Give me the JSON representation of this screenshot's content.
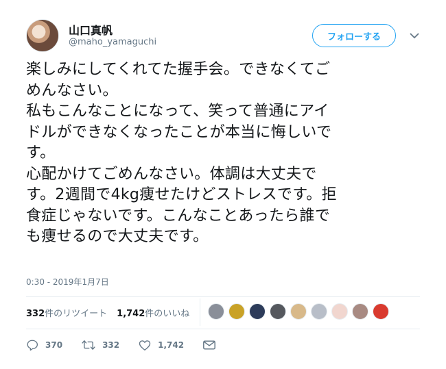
{
  "author": {
    "display_name": "山口真帆",
    "handle": "@maho_yamaguchi"
  },
  "follow_button_label": "フォローする",
  "tweet": {
    "lines": [
      "楽しみにしてくれてた握手会。できなくてご",
      "めんなさい。",
      "私もこんなことになって、笑って普通にアイ",
      "ドルができなくなったことが本当に悔しいで",
      "す。",
      "心配かけてごめんなさい。体調は大丈夫で",
      "す。2週間で4kg痩せたけどストレスです。拒",
      "食症じゃないです。こんなことあったら誰で",
      "も痩せるので大丈夫です。"
    ],
    "timestamp": "0:30 - 2019年1月7日"
  },
  "stats": {
    "retweets_count": "332",
    "retweets_label": "件のリツイート",
    "likes_count": "1,742",
    "likes_label": "件のいいね"
  },
  "liker_avatars": [
    {
      "color": "#8a8f99"
    },
    {
      "color": "#c9a227"
    },
    {
      "color": "#2d3c5a"
    },
    {
      "color": "#55585e"
    },
    {
      "color": "#d8b98a"
    },
    {
      "color": "#b8bec8"
    },
    {
      "color": "#f1d6cf"
    },
    {
      "color": "#a88a82"
    },
    {
      "color": "#d93a2f"
    }
  ],
  "actions": {
    "replies": "370",
    "retweets": "332",
    "likes": "1,742"
  },
  "colors": {
    "accent": "#1da1f2",
    "secondary_text": "#657786",
    "divider": "#e6ecf0"
  }
}
